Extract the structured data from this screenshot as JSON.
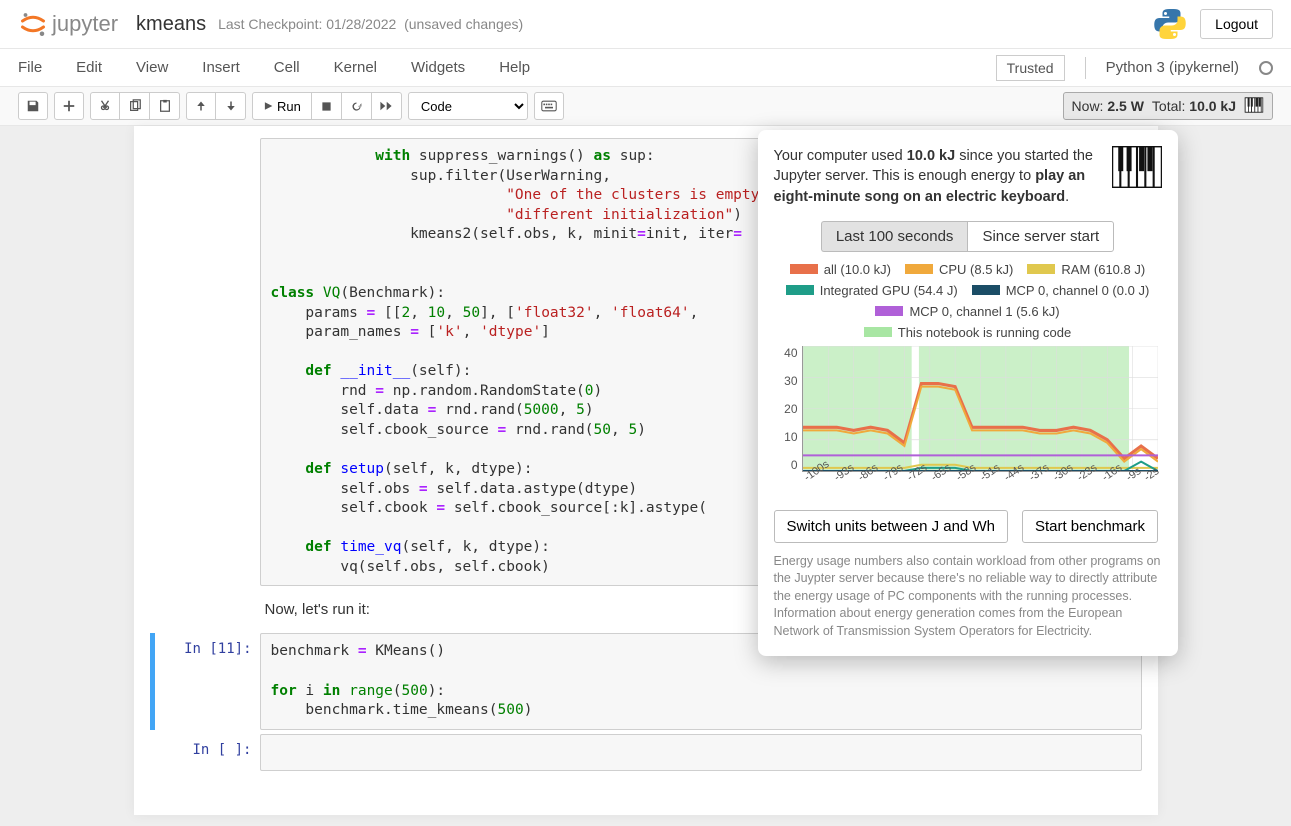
{
  "header": {
    "logo_text": "jupyter",
    "title": "kmeans",
    "checkpoint": "Last Checkpoint: 01/28/2022",
    "unsaved": "(unsaved changes)",
    "logout": "Logout"
  },
  "menu": {
    "items": [
      "File",
      "Edit",
      "View",
      "Insert",
      "Cell",
      "Kernel",
      "Widgets",
      "Help"
    ],
    "trusted": "Trusted",
    "kernel": "Python 3 (ipykernel)"
  },
  "toolbar": {
    "run": "Run",
    "cell_type": "Code",
    "energy_now_label": "Now:",
    "energy_now_value": "2.5 W",
    "energy_total_label": "Total:",
    "energy_total_value": "10.0 kJ"
  },
  "cells": {
    "md1": "Now, let's run it:",
    "prompt1": "In [11]:",
    "prompt2": "In [ ]:"
  },
  "popup": {
    "text1a": "Your computer used ",
    "text1b": "10.0 kJ",
    "text1c": " since you started the Jupyter server. This is enough energy to ",
    "text1d": "play an eight-minute song on an electric keyboard",
    "text1e": ".",
    "tab1": "Last 100 seconds",
    "tab2": "Since server start",
    "legend": [
      {
        "color": "#e8704a",
        "label": "all (10.0 kJ)"
      },
      {
        "color": "#f0a93c",
        "label": "CPU (8.5 kJ)"
      },
      {
        "color": "#e0c84e",
        "label": "RAM (610.8 J)"
      },
      {
        "color": "#1f9d88",
        "label": "Integrated GPU (54.4 J)"
      },
      {
        "color": "#1b4d66",
        "label": "MCP 0, channel 0 (0.0 J)"
      },
      {
        "color": "#b060d8",
        "label": "MCP 0, channel 1 (5.6 kJ)"
      },
      {
        "color": "#a8e6a3",
        "label": "This notebook is running code"
      }
    ],
    "btn1": "Switch units between J and Wh",
    "btn2": "Start benchmark",
    "foot1": "Energy usage numbers also contain workload from other programs on the Juypter server because there's no reliable way to directly attribute the energy usage of PC components with the running processes.",
    "foot2": "Information about energy generation comes from the European Network of Transmission System Operators for Electricity."
  },
  "chart_data": {
    "type": "line",
    "title": "",
    "xlabel": "",
    "ylabel": "",
    "ylim": [
      0,
      40
    ],
    "y_ticks": [
      0,
      10,
      20,
      30,
      40
    ],
    "x_ticks": [
      "-100s",
      "-93s",
      "-86s",
      "-79s",
      "-72s",
      "-65s",
      "-58s",
      "-51s",
      "-44s",
      "-37s",
      "-30s",
      "-23s",
      "-16s",
      "-9s",
      "-2s"
    ],
    "running_regions": [
      {
        "from": "-100s",
        "to": "-70s"
      },
      {
        "from": "-68s",
        "to": "-10s"
      }
    ],
    "series": [
      {
        "name": "all",
        "color": "#e8704a",
        "values": [
          14,
          14,
          14,
          13,
          14,
          13,
          9,
          28,
          28,
          27,
          14,
          14,
          14,
          14,
          13,
          13,
          14,
          13,
          10,
          4,
          8,
          4
        ]
      },
      {
        "name": "CPU",
        "color": "#f0a93c",
        "values": [
          13,
          13,
          13,
          12,
          13,
          12,
          8,
          27,
          27,
          26,
          13,
          13,
          13,
          13,
          12,
          12,
          13,
          12,
          9,
          3,
          7,
          3
        ]
      },
      {
        "name": "RAM",
        "color": "#e0c84e",
        "values": [
          1,
          1,
          1,
          1,
          1,
          1,
          1,
          2,
          2,
          2,
          1,
          1,
          1,
          1,
          1,
          1,
          1,
          1,
          1,
          1,
          1,
          1
        ]
      },
      {
        "name": "Integrated GPU",
        "color": "#1f9d88",
        "values": [
          0,
          0,
          0,
          0,
          0,
          0,
          0,
          1,
          1,
          1,
          0,
          0,
          0,
          0,
          0,
          0,
          0,
          0,
          0,
          0,
          3,
          0
        ]
      },
      {
        "name": "MCP 0 ch0",
        "color": "#1b4d66",
        "values": [
          0,
          0,
          0,
          0,
          0,
          0,
          0,
          0,
          0,
          0,
          0,
          0,
          0,
          0,
          0,
          0,
          0,
          0,
          0,
          0,
          0,
          0
        ]
      },
      {
        "name": "MCP 0 ch1",
        "color": "#b060d8",
        "values": [
          5,
          5,
          5,
          5,
          5,
          5,
          5,
          5,
          5,
          5,
          5,
          5,
          5,
          5,
          5,
          5,
          5,
          5,
          5,
          5,
          5,
          5
        ]
      }
    ]
  }
}
